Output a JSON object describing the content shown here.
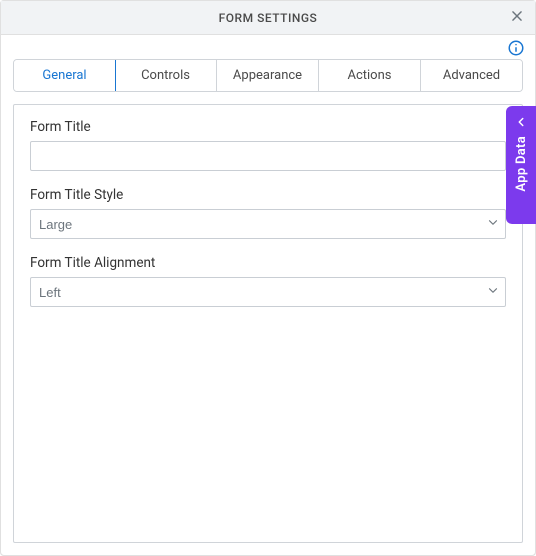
{
  "dialog": {
    "title": "FORM SETTINGS"
  },
  "tabs": [
    {
      "label": "General",
      "active": true
    },
    {
      "label": "Controls",
      "active": false
    },
    {
      "label": "Appearance",
      "active": false
    },
    {
      "label": "Actions",
      "active": false
    },
    {
      "label": "Advanced",
      "active": false
    }
  ],
  "fields": {
    "formTitle": {
      "label": "Form Title",
      "value": ""
    },
    "formTitleStyle": {
      "label": "Form Title Style",
      "value": "Large"
    },
    "formTitleAlignment": {
      "label": "Form Title Alignment",
      "value": "Left"
    }
  },
  "sidePanel": {
    "label": "App Data"
  }
}
